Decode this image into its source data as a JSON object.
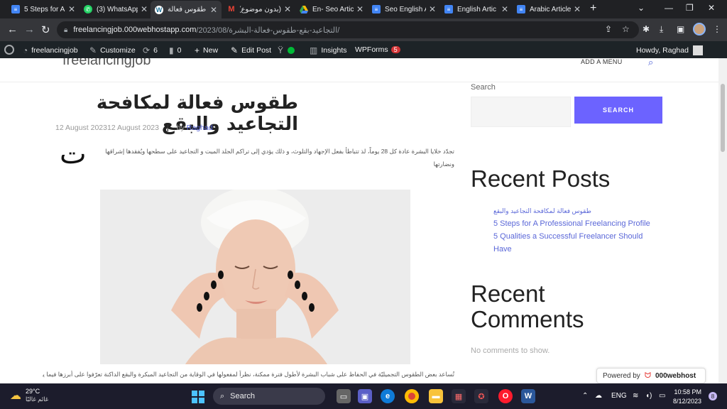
{
  "browser": {
    "tabs": [
      {
        "title": "5 Steps for A",
        "icon": "docs-icon"
      },
      {
        "title": "(3) WhatsApp",
        "icon": "whatsapp-icon"
      },
      {
        "title": "طقوس فعالة",
        "icon": "wordpress-icon",
        "active": true
      },
      {
        "title": "(بدون موضوع)",
        "icon": "gmail-icon"
      },
      {
        "title": "En- Seo Artic",
        "icon": "drive-icon"
      },
      {
        "title": "Seo English A",
        "icon": "docs-icon"
      },
      {
        "title": "English Artic",
        "icon": "docs-icon"
      },
      {
        "title": "Arabic Article",
        "icon": "docs-icon"
      }
    ],
    "url_host": "freelancingjob.000webhostapp.com",
    "url_path": "/2023/08/التجاعيد-بقع-طقوس-فعالة-البشرة/"
  },
  "wpbar": {
    "site": "freelancingjob",
    "customize": "Customize",
    "updates": "6",
    "comments": "0",
    "new": "New",
    "edit": "Edit Post",
    "insights": "Insights",
    "wpforms": "WPForms",
    "wpforms_badge": "5",
    "howdy": "Howdy, Raghad"
  },
  "site": {
    "title": "freelancingjob",
    "menu": "ADD A MENU"
  },
  "post": {
    "title": "طقوس فعالة لمكافحة التجاعيد والبقع",
    "date": "12 August 202312 August 2023",
    "by": "by",
    "author": "Raghad",
    "dropcap": "ت",
    "intro": "تجدّد خلايا البشرة عادة كل 28 يوماً، لذ تتباطأ بفعل الإجهاد والتلوث، و ذلك يؤدي إلى تراكم الجلد الميت و التجاعيد على سطحها ويُفقدها إشراقها ونضارتها",
    "bottom": "تُساعد بعض الطقوس التجميليّة في الحفاظ على شباب البشرة لأطول فترة ممكنة، نظراً لمفعولها في الوقاية من التجاعيد المبكرة والبقع الداكنة تعرّفوا على أبرزها فيما يلي"
  },
  "sidebar": {
    "search_label": "Search",
    "search_button": "SEARCH",
    "recent_posts_heading": "Recent Posts",
    "recent_posts": [
      "طقوس فعالة لمكافحة التجاعيد والبقع",
      "5 Steps for A Professional Freelancing Profile",
      "5 Qualities a Successful Freelancer Should Have"
    ],
    "recent_comments_heading": "Recent Comments",
    "no_comments": "No comments to show."
  },
  "powered": {
    "label": "Powered by",
    "brand": "000webhost"
  },
  "taskbar": {
    "temp": "29°C",
    "weather": "غائم غالبًا",
    "search": "Search",
    "lang": "ENG",
    "time": "10:58 PM",
    "date": "8/12/2023",
    "notifications": "8"
  },
  "colors": {
    "accent": "#6c63ff",
    "link": "#5a67d8",
    "wp_bar": "#1d2327",
    "chrome_dark": "#202124"
  }
}
